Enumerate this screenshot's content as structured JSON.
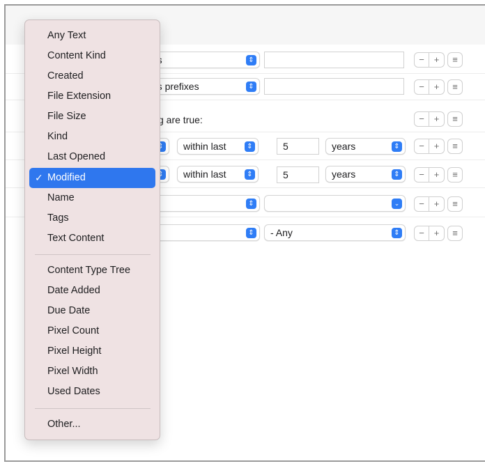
{
  "menu": {
    "items": [
      {
        "label": "Any Text"
      },
      {
        "label": "Content Kind"
      },
      {
        "label": "Created"
      },
      {
        "label": "File Extension"
      },
      {
        "label": "File Size"
      },
      {
        "label": "Kind"
      },
      {
        "label": "Last Opened"
      },
      {
        "label": "Modified",
        "selected": true
      },
      {
        "label": "Name"
      },
      {
        "label": "Tags"
      },
      {
        "label": "Text Content"
      },
      {
        "label": "Content Type Tree"
      },
      {
        "label": "Date Added"
      },
      {
        "label": "Due Date"
      },
      {
        "label": "Pixel Count"
      },
      {
        "label": "Pixel Height"
      },
      {
        "label": "Pixel Width"
      },
      {
        "label": "Used Dates"
      },
      {
        "label": "Other..."
      }
    ],
    "checkmark": "✓"
  },
  "rows": [
    {
      "operator": "ains",
      "value": ""
    },
    {
      "operator": "ains prefixes",
      "value": ""
    },
    {
      "text": "wing are true:"
    },
    {
      "operator": "within last",
      "amount": "5",
      "unit": "years"
    },
    {
      "operator": "within last",
      "amount": "5",
      "unit": "years"
    },
    {
      "operator": "",
      "value": ""
    },
    {
      "operator": "",
      "value": "- Any"
    }
  ],
  "buttons": {
    "minus": "−",
    "plus": "+",
    "menu": "≡"
  },
  "accent_color": "#2f77ee"
}
